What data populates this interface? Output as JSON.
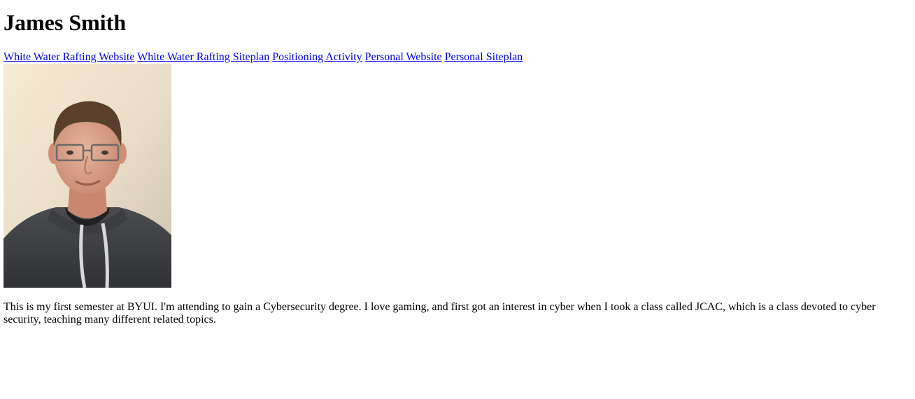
{
  "page": {
    "heading": "James Smith",
    "nav_links": [
      {
        "label": "White Water Rafting Website"
      },
      {
        "label": "White Water Rafting Siteplan"
      },
      {
        "label": "Positioning Activity"
      },
      {
        "label": "Personal Website"
      },
      {
        "label": "Personal Siteplan"
      }
    ],
    "photo": {
      "subject": "portrait-photo"
    },
    "bio": "This is my first semester at BYUI. I'm attending to gain a Cybersecurity degree. I love gaming, and first got an interest in cyber when I took a class called JCAC, which is a class devoted to cyber security, teaching many different related topics."
  },
  "colors": {
    "link": "#0000ee",
    "text": "#000000",
    "background": "#ffffff"
  }
}
